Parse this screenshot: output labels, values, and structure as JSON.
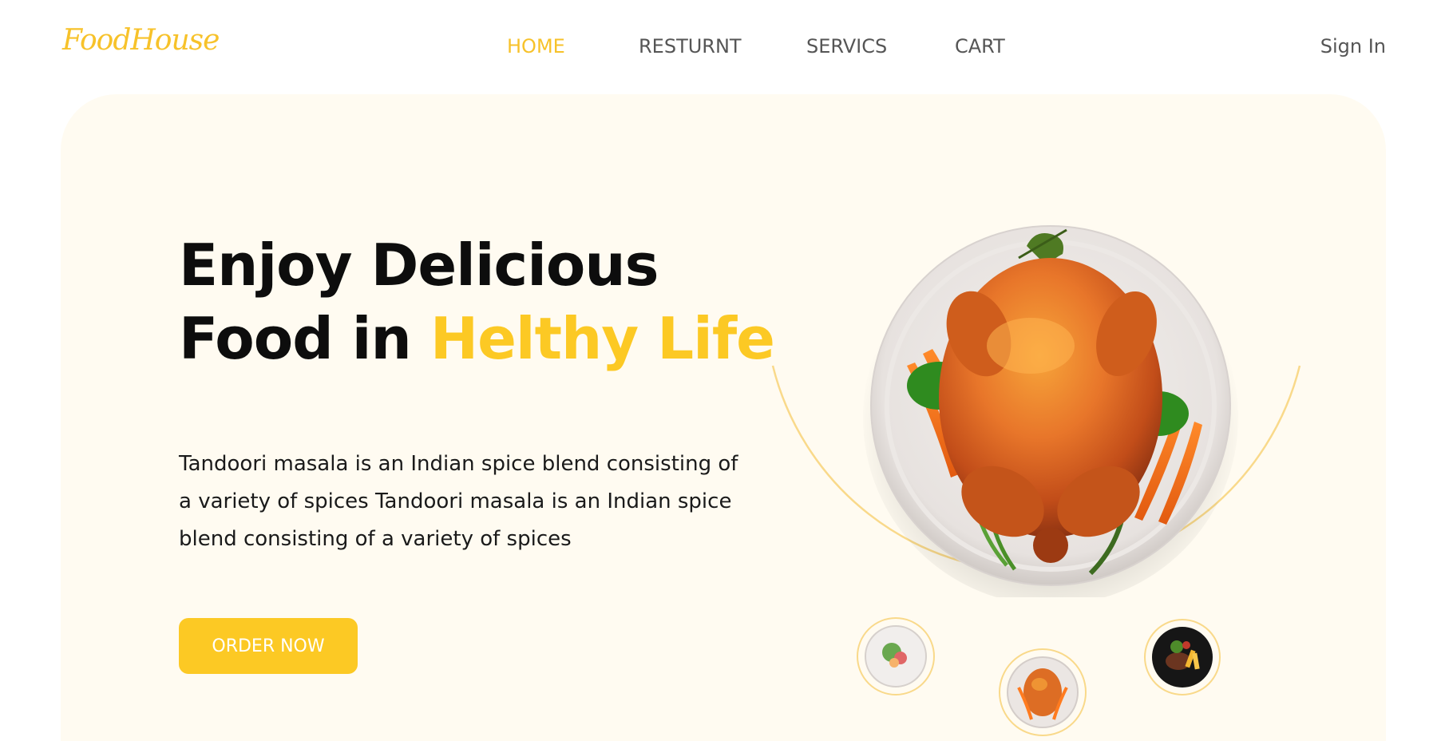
{
  "header": {
    "logo": "FoodHouse",
    "nav": [
      "HOME",
      "RESTURNT",
      "SERVICS",
      "CART"
    ],
    "active_nav": "HOME",
    "sign_in": "Sign In"
  },
  "hero": {
    "title_line1": "Enjoy Delicious",
    "title_line2_plain": "Food in",
    "title_line2_accent": "Helthy Life",
    "description": "Tandoori masala is an Indian spice blend consisting of a variety of spices Tandoori masala is an Indian spice blend consisting of a variety of spices",
    "cta": "ORDER NOW"
  },
  "colors": {
    "accent": "#fcc924",
    "hero_bg": "#fffbf1",
    "nav_text": "#555555"
  },
  "images": {
    "main_dish": "roast-chicken-plate",
    "thumbnails": [
      "salad-plate-thumbnail",
      "roast-chicken-thumbnail",
      "steak-fries-thumbnail"
    ]
  }
}
